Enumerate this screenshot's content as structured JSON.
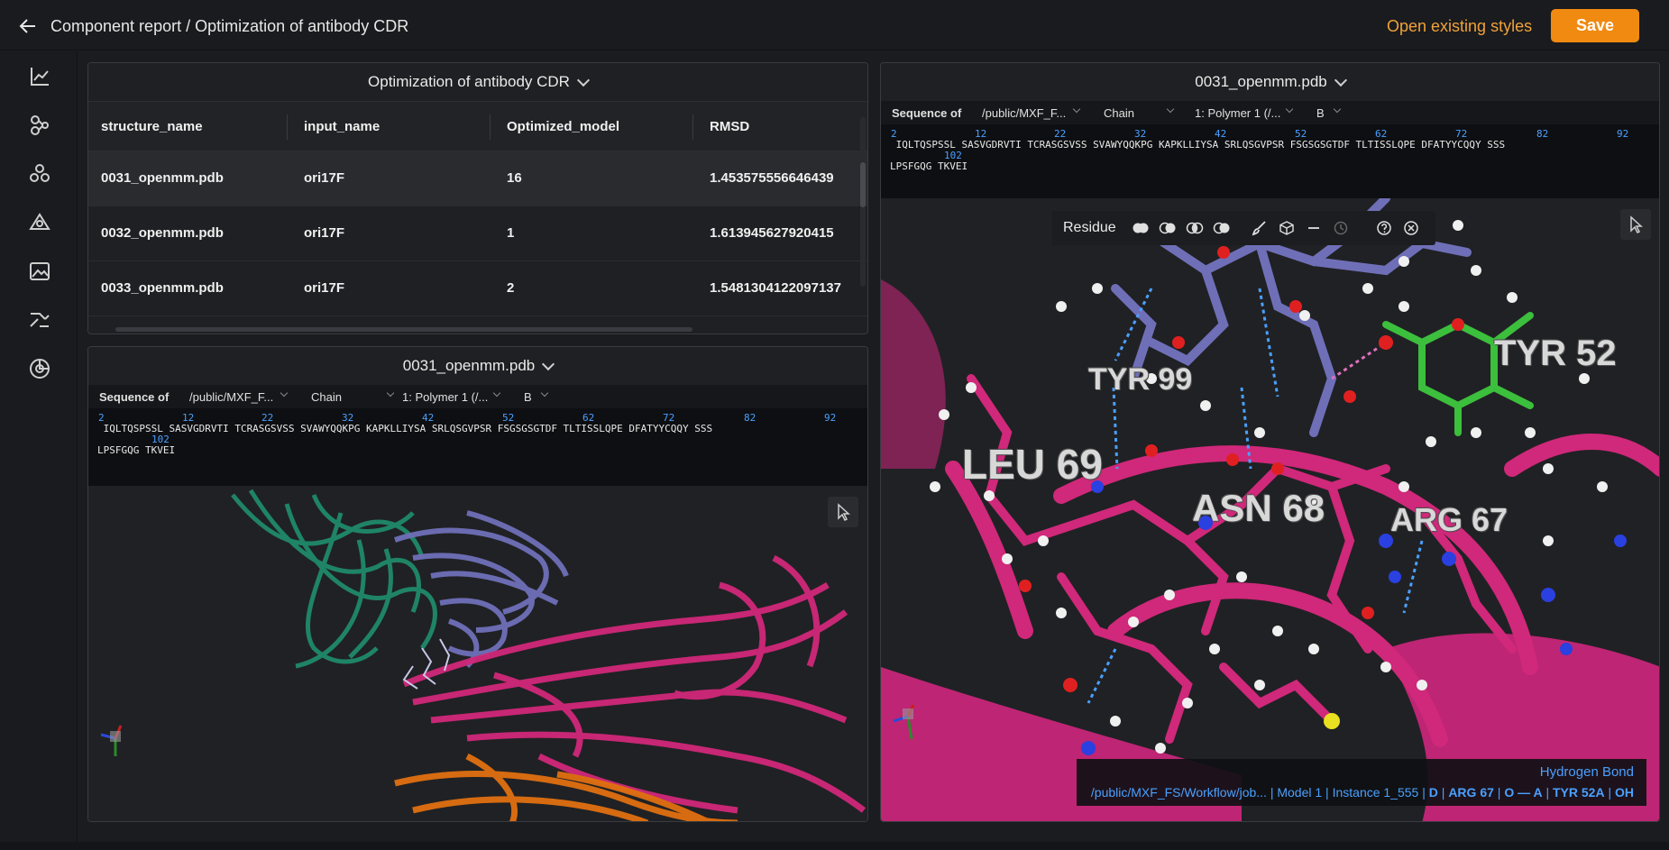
{
  "header": {
    "breadcrumb": "Component report / Optimization of antibody CDR",
    "open_styles": "Open existing styles",
    "save": "Save"
  },
  "sidebar": {
    "icons": [
      "line-chart-icon",
      "molecule-icon",
      "cluster-icon",
      "network-icon",
      "image-icon",
      "workflow-icon",
      "pie-chart-icon"
    ]
  },
  "table_panel": {
    "title": "Optimization of antibody CDR",
    "columns": [
      "structure_name",
      "input_name",
      "Optimized_model",
      "RMSD"
    ],
    "rows": [
      [
        "0031_openmm.pdb",
        "ori17F",
        "16",
        "1.453575556646439"
      ],
      [
        "0032_openmm.pdb",
        "ori17F",
        "1",
        "1.613945627920415"
      ],
      [
        "0033_openmm.pdb",
        "ori17F",
        "2",
        "1.5481304122097137"
      ]
    ]
  },
  "left_viewer": {
    "title": "0031_openmm.pdb",
    "seq_label": "Sequence of",
    "path": "/public/MXF_F...",
    "chain_label": "Chain",
    "polymer": "1: Polymer 1 (/...",
    "chain_value": "B",
    "numbers": [
      "2",
      "12",
      "22",
      "32",
      "42",
      "52",
      "62",
      "72",
      "82",
      "92",
      "102"
    ],
    "line1": " IQLTQSPSSL SASVGDRVTI TCRASGSVSS SVAWYQQKPG KAPKLLIYSA SRLQSGVPSR FSGSGSGTDF TLTISSLQPE DFATYYCQQY SSS",
    "line2": "LPSFGQG TKVEI"
  },
  "right_viewer": {
    "title": "0031_openmm.pdb",
    "seq_label": "Sequence of",
    "path": "/public/MXF_F...",
    "chain_label": "Chain",
    "polymer": "1: Polymer 1 (/...",
    "chain_value": "B",
    "numbers": [
      "2",
      "12",
      "22",
      "32",
      "42",
      "52",
      "62",
      "72",
      "82",
      "92",
      "102"
    ],
    "line1": " IQLTQSPSSL SASVGDRVTI TCRASGSVSS SVAWYQQKPG KAPKLLIYSA SRLQSGVPSR FSGSGSGTDF TLTISSLQPE DFATYYCQQY SSS",
    "line2": "LPSFGQG TKVEI",
    "toolbar_label": "Residue",
    "residues": [
      "TYR 99",
      "TYR 52",
      "LEU 69",
      "ASN 68",
      "ARG 67"
    ],
    "hbond": {
      "title": "Hydrogen Bond",
      "path": "/public/MXF_FS/Workflow/job...",
      "model": "Model 1",
      "instance": "Instance 1_555",
      "d": "D",
      "d_res": "ARG 67",
      "o": "O — A",
      "o_res": "TYR 52A",
      "o_atom": "OH"
    }
  },
  "colors": {
    "accent": "#f08a10",
    "link": "#f0a23a",
    "seq_number": "#4aa0ff",
    "chain_green": "#1f8a6a",
    "chain_purple": "#6f6fb8",
    "chain_magenta": "#d0287a",
    "chain_orange": "#e07010"
  }
}
